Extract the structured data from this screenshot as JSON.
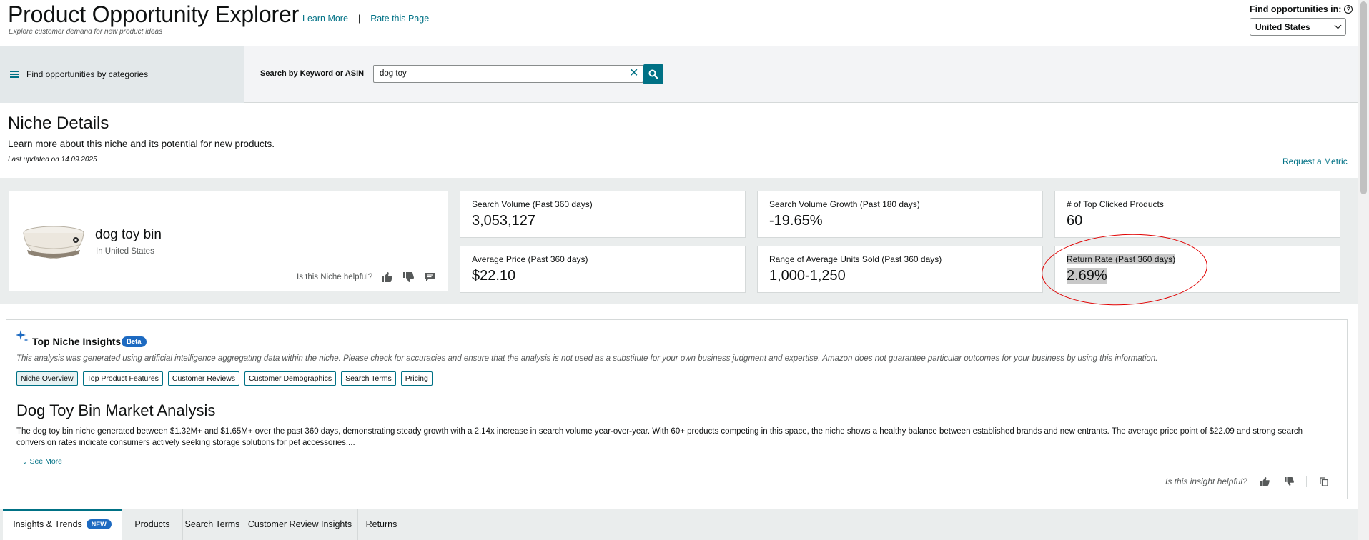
{
  "header": {
    "title": "Product Opportunity Explorer",
    "subtitle": "Explore customer demand for new product ideas",
    "links": {
      "learn_more": "Learn More",
      "separator": "|",
      "rate_page": "Rate this Page"
    },
    "find_label": "Find opportunities in:",
    "country": "United States"
  },
  "search": {
    "categories_label": "Find opportunities by categories",
    "label": "Search by Keyword or ASIN",
    "value": "dog toy"
  },
  "niche": {
    "title": "Niche Details",
    "description": "Learn more about this niche and its potential for new products.",
    "updated": "Last updated on 14.09.2025",
    "request_metric": "Request a Metric",
    "product_name": "dog toy bin",
    "location": "In United States",
    "helpful_q": "Is this Niche helpful?"
  },
  "metrics": [
    {
      "label": "Search Volume (Past 360 days)",
      "value": "3,053,127"
    },
    {
      "label": "Search Volume Growth (Past 180 days)",
      "value": "-19.65%"
    },
    {
      "label": "# of Top Clicked Products",
      "value": "60"
    },
    {
      "label": "Average Price (Past 360 days)",
      "value": "$22.10"
    },
    {
      "label": "Range of Average Units Sold (Past 360 days)",
      "value": "1,000-1,250"
    },
    {
      "label": "Return Rate (Past 360 days)",
      "value": "2.69%"
    }
  ],
  "insights": {
    "title": "Top Niche Insights",
    "badge": "Beta",
    "disclaimer": "This analysis was generated using artificial intelligence aggregating data within the niche. Please check for accuracies and ensure that the analysis is not used as a substitute for your own business judgment and expertise. Amazon does not guarantee particular outcomes for your business by using this information.",
    "chips": [
      "Niche Overview",
      "Top Product Features",
      "Customer Reviews",
      "Customer Demographics",
      "Search Terms",
      "Pricing"
    ],
    "heading": "Dog Toy Bin Market Analysis",
    "body": "The dog toy bin niche generated between $1.32M+ and $1.65M+ over the past 360 days, demonstrating steady growth with a 2.14x increase in search volume year-over-year. With 60+ products competing in this space, the niche shows a healthy balance between established brands and new entrants. The average price point of $22.09 and strong search conversion rates indicate consumers actively seeking storage solutions for pet accessories....",
    "see_more": "See More",
    "helpful_q": "Is this insight helpful?"
  },
  "tabs": [
    {
      "label": "Insights & Trends",
      "badge": "NEW"
    },
    {
      "label": "Products"
    },
    {
      "label": "Search Terms"
    },
    {
      "label": "Customer Review Insights"
    },
    {
      "label": "Returns"
    }
  ],
  "colors": {
    "accent": "#007185",
    "badge": "#1d6ac1",
    "annotation": "#e00000"
  }
}
